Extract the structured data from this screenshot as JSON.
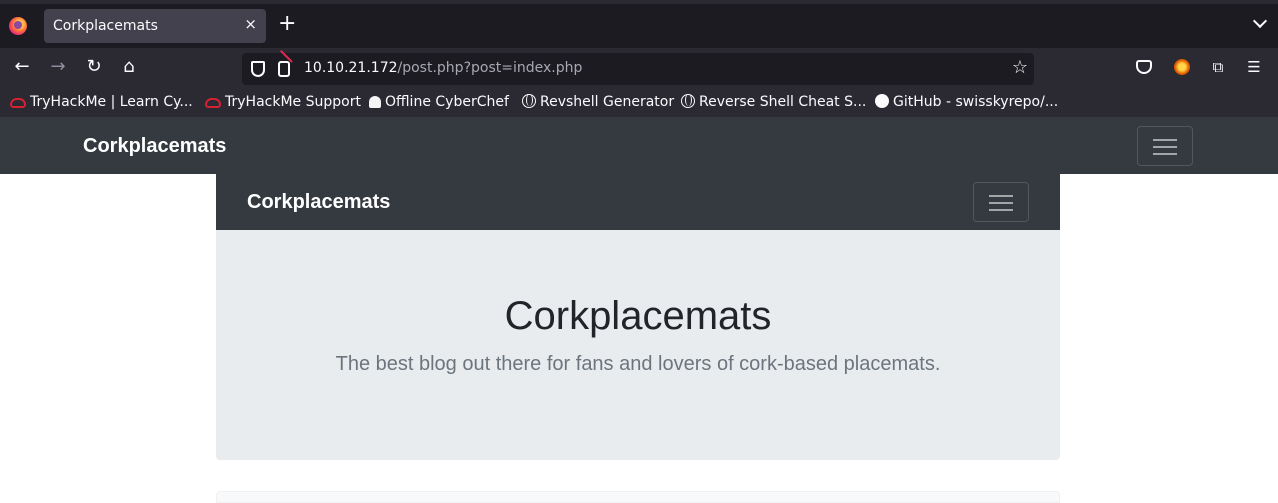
{
  "browser": {
    "tab_title": "Corkplacemats",
    "tab_close": "×",
    "new_tab": "+",
    "url_host": "10.10.21.172",
    "url_rest": "/post.php?post=index.php",
    "bookmarks": [
      {
        "label": "TryHackMe | Learn Cy...",
        "icon": "tryhackme-icon"
      },
      {
        "label": "TryHackMe Support",
        "icon": "tryhackme-icon"
      },
      {
        "label": "Offline CyberChef",
        "icon": "cyberchef-icon"
      },
      {
        "label": "Revshell Generator",
        "icon": "globe-icon"
      },
      {
        "label": "Reverse Shell Cheat S...",
        "icon": "globe-icon"
      },
      {
        "label": "GitHub - swisskyrepo/...",
        "icon": "github-icon"
      }
    ]
  },
  "site": {
    "brand": "Corkplacemats",
    "inner_brand": "Corkplacemats",
    "jumbotron": {
      "title": "Corkplacemats",
      "lead": "The best blog out there for fans and lovers of cork-based placemats."
    },
    "colors": {
      "navbar": "#343a40",
      "jumbotron": "#e9ecef",
      "lead_text": "#6c757d"
    }
  }
}
